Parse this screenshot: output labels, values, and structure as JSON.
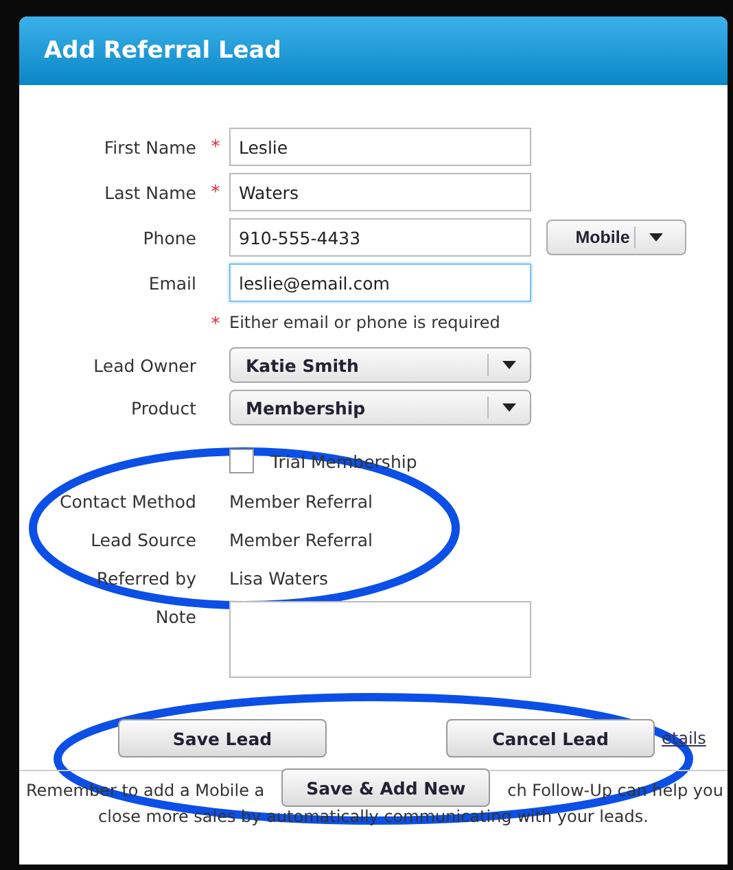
{
  "window": {
    "title": "Add Referral Lead"
  },
  "fields": [
    {
      "label": "First Name",
      "required": true,
      "value": "Leslie",
      "focused": false
    },
    {
      "label": "Last Name",
      "required": true,
      "value": "Waters",
      "focused": false
    },
    {
      "label": "Phone",
      "required": false,
      "value": "910-555-4433",
      "focused": false
    },
    {
      "label": "Email",
      "required": false,
      "value": "leslie@email.com",
      "focused": true
    }
  ],
  "phone_type": "Mobile",
  "hint": {
    "mark": "*",
    "text": "Either email or phone is required"
  },
  "selects": [
    {
      "label": "Lead Owner",
      "value": "Katie Smith"
    },
    {
      "label": "Product",
      "value": "Membership"
    }
  ],
  "trial": {
    "label": "Trial Membership",
    "checked": false
  },
  "details": [
    {
      "label": "Contact Method",
      "value": "Member Referral"
    },
    {
      "label": "Lead Source",
      "value": "Member Referral"
    },
    {
      "label": "Referred by",
      "value": "Lisa Waters"
    }
  ],
  "note": {
    "label": "Note"
  },
  "buttons": [
    {
      "label": "Save Lead"
    },
    {
      "label": "Cancel Lead"
    }
  ],
  "link": "etails",
  "save_new": "Save & Add New",
  "footer": {
    "left": "Remember to add a Mobile a",
    "right": "ch Follow-Up can help you",
    "line2": "close more sales by automatically communicating with your leads."
  }
}
